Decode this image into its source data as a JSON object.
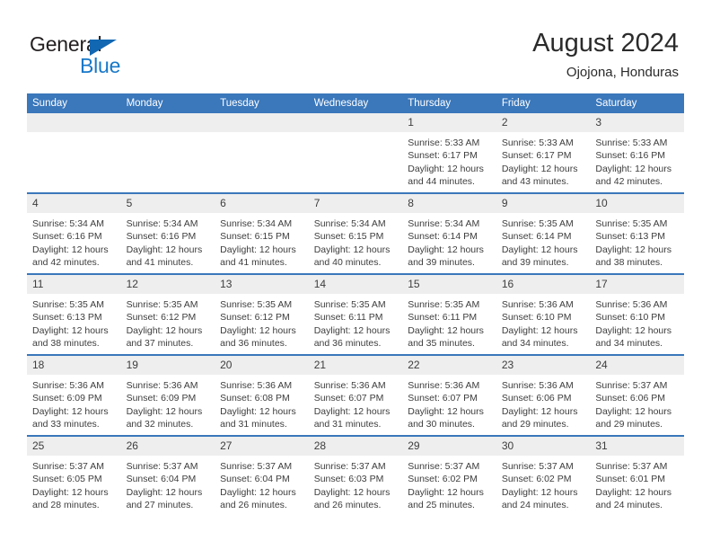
{
  "brand": {
    "name_part1": "General",
    "name_part2": "Blue",
    "triangle_color": "#1267b2",
    "blue_color": "#1878c8"
  },
  "header": {
    "title": "August 2024",
    "subtitle": "Ojojona, Honduras",
    "header_bg": "#3a77bb",
    "daynum_bg": "#eeeeee"
  },
  "weekday_headers": [
    "Sunday",
    "Monday",
    "Tuesday",
    "Wednesday",
    "Thursday",
    "Friday",
    "Saturday"
  ],
  "weeks": [
    [
      {
        "day": "",
        "sunrise": "",
        "sunset": "",
        "daylight_line1": "",
        "daylight_line2": ""
      },
      {
        "day": "",
        "sunrise": "",
        "sunset": "",
        "daylight_line1": "",
        "daylight_line2": ""
      },
      {
        "day": "",
        "sunrise": "",
        "sunset": "",
        "daylight_line1": "",
        "daylight_line2": ""
      },
      {
        "day": "",
        "sunrise": "",
        "sunset": "",
        "daylight_line1": "",
        "daylight_line2": ""
      },
      {
        "day": "1",
        "sunrise": "Sunrise: 5:33 AM",
        "sunset": "Sunset: 6:17 PM",
        "daylight_line1": "Daylight: 12 hours",
        "daylight_line2": "and 44 minutes."
      },
      {
        "day": "2",
        "sunrise": "Sunrise: 5:33 AM",
        "sunset": "Sunset: 6:17 PM",
        "daylight_line1": "Daylight: 12 hours",
        "daylight_line2": "and 43 minutes."
      },
      {
        "day": "3",
        "sunrise": "Sunrise: 5:33 AM",
        "sunset": "Sunset: 6:16 PM",
        "daylight_line1": "Daylight: 12 hours",
        "daylight_line2": "and 42 minutes."
      }
    ],
    [
      {
        "day": "4",
        "sunrise": "Sunrise: 5:34 AM",
        "sunset": "Sunset: 6:16 PM",
        "daylight_line1": "Daylight: 12 hours",
        "daylight_line2": "and 42 minutes."
      },
      {
        "day": "5",
        "sunrise": "Sunrise: 5:34 AM",
        "sunset": "Sunset: 6:16 PM",
        "daylight_line1": "Daylight: 12 hours",
        "daylight_line2": "and 41 minutes."
      },
      {
        "day": "6",
        "sunrise": "Sunrise: 5:34 AM",
        "sunset": "Sunset: 6:15 PM",
        "daylight_line1": "Daylight: 12 hours",
        "daylight_line2": "and 41 minutes."
      },
      {
        "day": "7",
        "sunrise": "Sunrise: 5:34 AM",
        "sunset": "Sunset: 6:15 PM",
        "daylight_line1": "Daylight: 12 hours",
        "daylight_line2": "and 40 minutes."
      },
      {
        "day": "8",
        "sunrise": "Sunrise: 5:34 AM",
        "sunset": "Sunset: 6:14 PM",
        "daylight_line1": "Daylight: 12 hours",
        "daylight_line2": "and 39 minutes."
      },
      {
        "day": "9",
        "sunrise": "Sunrise: 5:35 AM",
        "sunset": "Sunset: 6:14 PM",
        "daylight_line1": "Daylight: 12 hours",
        "daylight_line2": "and 39 minutes."
      },
      {
        "day": "10",
        "sunrise": "Sunrise: 5:35 AM",
        "sunset": "Sunset: 6:13 PM",
        "daylight_line1": "Daylight: 12 hours",
        "daylight_line2": "and 38 minutes."
      }
    ],
    [
      {
        "day": "11",
        "sunrise": "Sunrise: 5:35 AM",
        "sunset": "Sunset: 6:13 PM",
        "daylight_line1": "Daylight: 12 hours",
        "daylight_line2": "and 38 minutes."
      },
      {
        "day": "12",
        "sunrise": "Sunrise: 5:35 AM",
        "sunset": "Sunset: 6:12 PM",
        "daylight_line1": "Daylight: 12 hours",
        "daylight_line2": "and 37 minutes."
      },
      {
        "day": "13",
        "sunrise": "Sunrise: 5:35 AM",
        "sunset": "Sunset: 6:12 PM",
        "daylight_line1": "Daylight: 12 hours",
        "daylight_line2": "and 36 minutes."
      },
      {
        "day": "14",
        "sunrise": "Sunrise: 5:35 AM",
        "sunset": "Sunset: 6:11 PM",
        "daylight_line1": "Daylight: 12 hours",
        "daylight_line2": "and 36 minutes."
      },
      {
        "day": "15",
        "sunrise": "Sunrise: 5:35 AM",
        "sunset": "Sunset: 6:11 PM",
        "daylight_line1": "Daylight: 12 hours",
        "daylight_line2": "and 35 minutes."
      },
      {
        "day": "16",
        "sunrise": "Sunrise: 5:36 AM",
        "sunset": "Sunset: 6:10 PM",
        "daylight_line1": "Daylight: 12 hours",
        "daylight_line2": "and 34 minutes."
      },
      {
        "day": "17",
        "sunrise": "Sunrise: 5:36 AM",
        "sunset": "Sunset: 6:10 PM",
        "daylight_line1": "Daylight: 12 hours",
        "daylight_line2": "and 34 minutes."
      }
    ],
    [
      {
        "day": "18",
        "sunrise": "Sunrise: 5:36 AM",
        "sunset": "Sunset: 6:09 PM",
        "daylight_line1": "Daylight: 12 hours",
        "daylight_line2": "and 33 minutes."
      },
      {
        "day": "19",
        "sunrise": "Sunrise: 5:36 AM",
        "sunset": "Sunset: 6:09 PM",
        "daylight_line1": "Daylight: 12 hours",
        "daylight_line2": "and 32 minutes."
      },
      {
        "day": "20",
        "sunrise": "Sunrise: 5:36 AM",
        "sunset": "Sunset: 6:08 PM",
        "daylight_line1": "Daylight: 12 hours",
        "daylight_line2": "and 31 minutes."
      },
      {
        "day": "21",
        "sunrise": "Sunrise: 5:36 AM",
        "sunset": "Sunset: 6:07 PM",
        "daylight_line1": "Daylight: 12 hours",
        "daylight_line2": "and 31 minutes."
      },
      {
        "day": "22",
        "sunrise": "Sunrise: 5:36 AM",
        "sunset": "Sunset: 6:07 PM",
        "daylight_line1": "Daylight: 12 hours",
        "daylight_line2": "and 30 minutes."
      },
      {
        "day": "23",
        "sunrise": "Sunrise: 5:36 AM",
        "sunset": "Sunset: 6:06 PM",
        "daylight_line1": "Daylight: 12 hours",
        "daylight_line2": "and 29 minutes."
      },
      {
        "day": "24",
        "sunrise": "Sunrise: 5:37 AM",
        "sunset": "Sunset: 6:06 PM",
        "daylight_line1": "Daylight: 12 hours",
        "daylight_line2": "and 29 minutes."
      }
    ],
    [
      {
        "day": "25",
        "sunrise": "Sunrise: 5:37 AM",
        "sunset": "Sunset: 6:05 PM",
        "daylight_line1": "Daylight: 12 hours",
        "daylight_line2": "and 28 minutes."
      },
      {
        "day": "26",
        "sunrise": "Sunrise: 5:37 AM",
        "sunset": "Sunset: 6:04 PM",
        "daylight_line1": "Daylight: 12 hours",
        "daylight_line2": "and 27 minutes."
      },
      {
        "day": "27",
        "sunrise": "Sunrise: 5:37 AM",
        "sunset": "Sunset: 6:04 PM",
        "daylight_line1": "Daylight: 12 hours",
        "daylight_line2": "and 26 minutes."
      },
      {
        "day": "28",
        "sunrise": "Sunrise: 5:37 AM",
        "sunset": "Sunset: 6:03 PM",
        "daylight_line1": "Daylight: 12 hours",
        "daylight_line2": "and 26 minutes."
      },
      {
        "day": "29",
        "sunrise": "Sunrise: 5:37 AM",
        "sunset": "Sunset: 6:02 PM",
        "daylight_line1": "Daylight: 12 hours",
        "daylight_line2": "and 25 minutes."
      },
      {
        "day": "30",
        "sunrise": "Sunrise: 5:37 AM",
        "sunset": "Sunset: 6:02 PM",
        "daylight_line1": "Daylight: 12 hours",
        "daylight_line2": "and 24 minutes."
      },
      {
        "day": "31",
        "sunrise": "Sunrise: 5:37 AM",
        "sunset": "Sunset: 6:01 PM",
        "daylight_line1": "Daylight: 12 hours",
        "daylight_line2": "and 24 minutes."
      }
    ]
  ]
}
